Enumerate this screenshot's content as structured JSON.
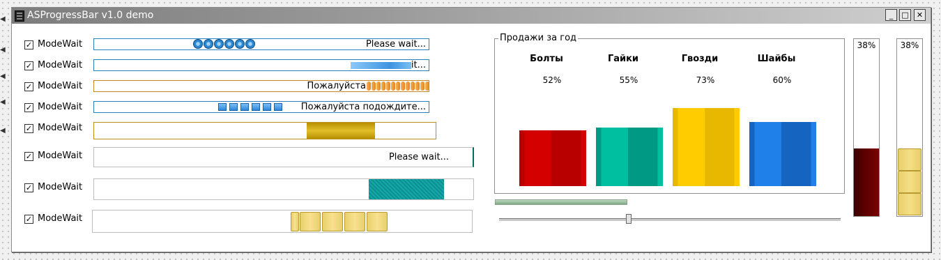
{
  "window": {
    "title": "ASProgressBar v1.0 demo",
    "minimize_glyph": "_",
    "maximize_glyph": "□",
    "close_glyph": "✕"
  },
  "rows": [
    {
      "checkbox_label": "ModeWait",
      "checked": true,
      "bar_text": "Please wait..."
    },
    {
      "checkbox_label": "ModeWait",
      "checked": true,
      "bar_text": "it..."
    },
    {
      "checkbox_label": "ModeWait",
      "checked": true,
      "bar_text": "Пожалуйста"
    },
    {
      "checkbox_label": "ModeWait",
      "checked": true,
      "bar_text": "Пожалуйста подождите..."
    },
    {
      "checkbox_label": "ModeWait",
      "checked": true,
      "bar_text": ""
    },
    {
      "checkbox_label": "ModeWait",
      "checked": true,
      "bar_text": "Please wait..."
    },
    {
      "checkbox_label": "ModeWait",
      "checked": true,
      "bar_text": ""
    },
    {
      "checkbox_label": "ModeWait",
      "checked": true,
      "bar_text": ""
    }
  ],
  "check_glyph": "✓",
  "sales": {
    "group_title": "Продажи за год",
    "columns": [
      {
        "name": "Болты",
        "percent_text": "52%",
        "value": 52,
        "color": "#d40000",
        "color_dark": "#b80000"
      },
      {
        "name": "Гайки",
        "percent_text": "55%",
        "value": 55,
        "color": "#00bfa0",
        "color_dark": "#009a84"
      },
      {
        "name": "Гвозди",
        "percent_text": "73%",
        "value": 73,
        "color": "#ffcc00",
        "color_dark": "#e8b800"
      },
      {
        "name": "Шайбы",
        "percent_text": "60%",
        "value": 60,
        "color": "#1e80e8",
        "color_dark": "#1565c0"
      }
    ]
  },
  "vertical_bars": [
    {
      "label": "38%",
      "value": 38,
      "style": "fill",
      "color": "#5a0000"
    },
    {
      "label": "38%",
      "value": 38,
      "style": "blocks",
      "color": "#f5df85"
    }
  ],
  "horizontal_progress_value": 38,
  "slider_value": 38
}
